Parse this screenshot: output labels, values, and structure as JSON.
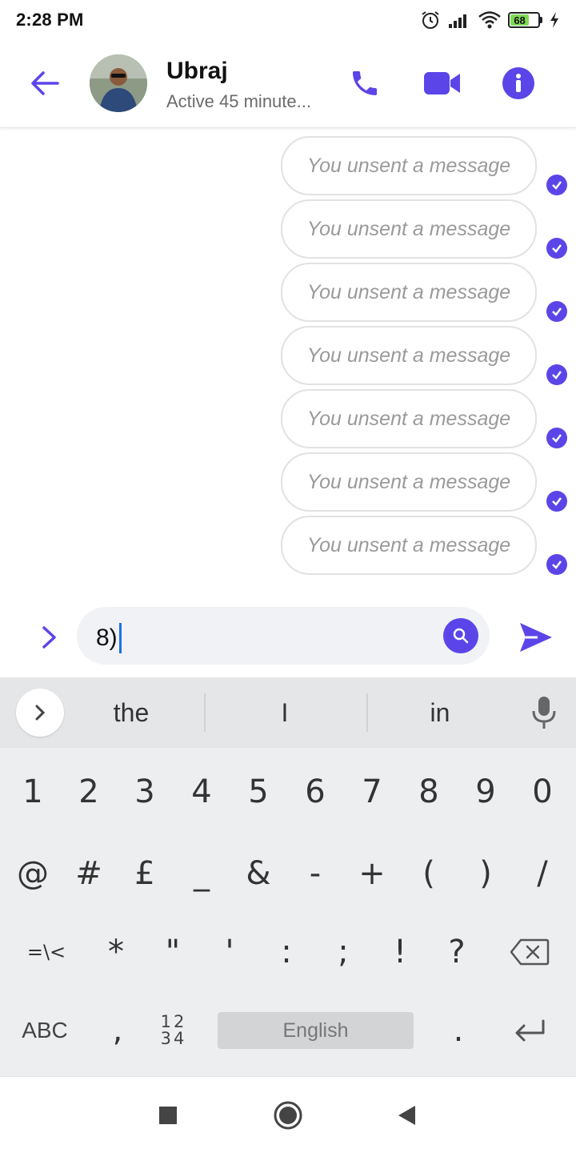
{
  "status": {
    "time": "2:28 PM",
    "battery": "68"
  },
  "header": {
    "name": "Ubraj",
    "active_status": "Active 45 minute..."
  },
  "messages": [
    {
      "text": "You unsent a message"
    },
    {
      "text": "You unsent a message"
    },
    {
      "text": "You unsent a message"
    },
    {
      "text": "You unsent a message"
    },
    {
      "text": "You unsent a message"
    },
    {
      "text": "You unsent a message"
    },
    {
      "text": "You unsent a message"
    }
  ],
  "composer": {
    "value": "8)"
  },
  "keyboard": {
    "suggestions": [
      "the",
      "I",
      "in"
    ],
    "row1": [
      "1",
      "2",
      "3",
      "4",
      "5",
      "6",
      "7",
      "8",
      "9",
      "0"
    ],
    "row2": [
      "@",
      "#",
      "£",
      "_",
      "&",
      "-",
      "+",
      "(",
      ")",
      "/"
    ],
    "row3": [
      "=\\<",
      "*",
      "\"",
      "'",
      ":",
      ";",
      "!",
      "?"
    ],
    "bottom": {
      "abc": "ABC",
      "comma": ",",
      "num_top": "12",
      "num_bottom": "34",
      "space": "English",
      "period": "."
    }
  },
  "colors": {
    "accent": "#5b45e8",
    "bubble_border": "#e2e2e2",
    "unsent_text": "#9a9a9a"
  }
}
